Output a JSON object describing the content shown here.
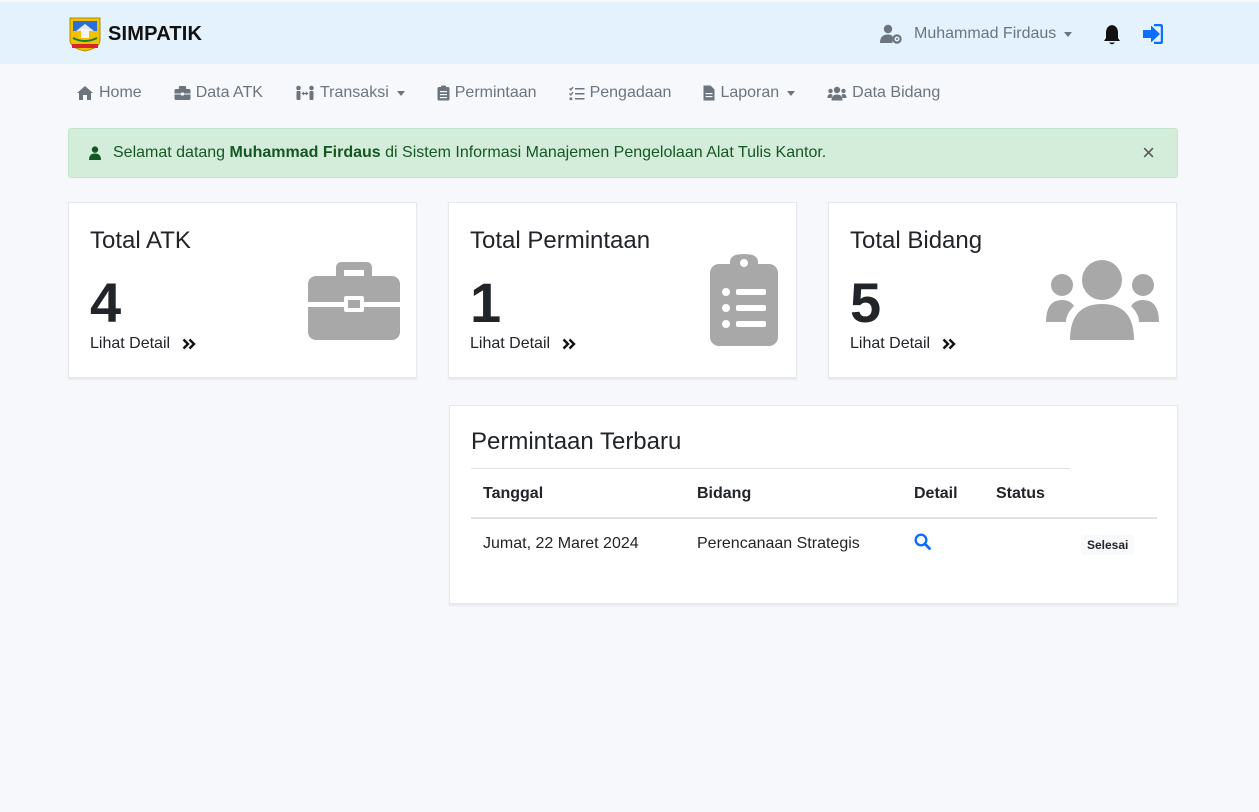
{
  "app": {
    "title": "SIMPATIK"
  },
  "header": {
    "user_name": "Muhammad Firdaus"
  },
  "nav": {
    "items": [
      {
        "label": "Home",
        "icon": "home-icon"
      },
      {
        "label": "Data ATK",
        "icon": "briefcase-icon"
      },
      {
        "label": "Transaksi",
        "icon": "people-arrows-icon",
        "dropdown": true
      },
      {
        "label": "Permintaan",
        "icon": "clipboard-icon"
      },
      {
        "label": "Pengadaan",
        "icon": "list-check-icon"
      },
      {
        "label": "Laporan",
        "icon": "file-icon",
        "dropdown": true
      },
      {
        "label": "Data Bidang",
        "icon": "users-icon"
      }
    ]
  },
  "alert": {
    "prefix": "Selamat datang",
    "name": "Muhammad Firdaus",
    "suffix": "di Sistem Informasi Manajemen Pengelolaan Alat Tulis Kantor.",
    "close": "×"
  },
  "stats": [
    {
      "title": "Total ATK",
      "value": "4",
      "link": "Lihat Detail",
      "icon": "briefcase-icon"
    },
    {
      "title": "Total Permintaan",
      "value": "1",
      "link": "Lihat Detail",
      "icon": "clipboard-list-icon"
    },
    {
      "title": "Total Bidang",
      "value": "5",
      "link": "Lihat Detail",
      "icon": "users-icon"
    }
  ],
  "recent": {
    "title": "Permintaan Terbaru",
    "columns": [
      "Tanggal",
      "Bidang",
      "Detail",
      "Status"
    ],
    "rows": [
      {
        "tanggal": "Jumat, 22 Maret 2024",
        "bidang": "Perencanaan Strategis",
        "status": "Selesai"
      }
    ]
  },
  "colors": {
    "accent": "#0d6efd",
    "topbar": "#e3f2fd",
    "alert_bg": "#d4edda",
    "alert_text": "#155724",
    "icon_gray": "#a8a8a8"
  }
}
